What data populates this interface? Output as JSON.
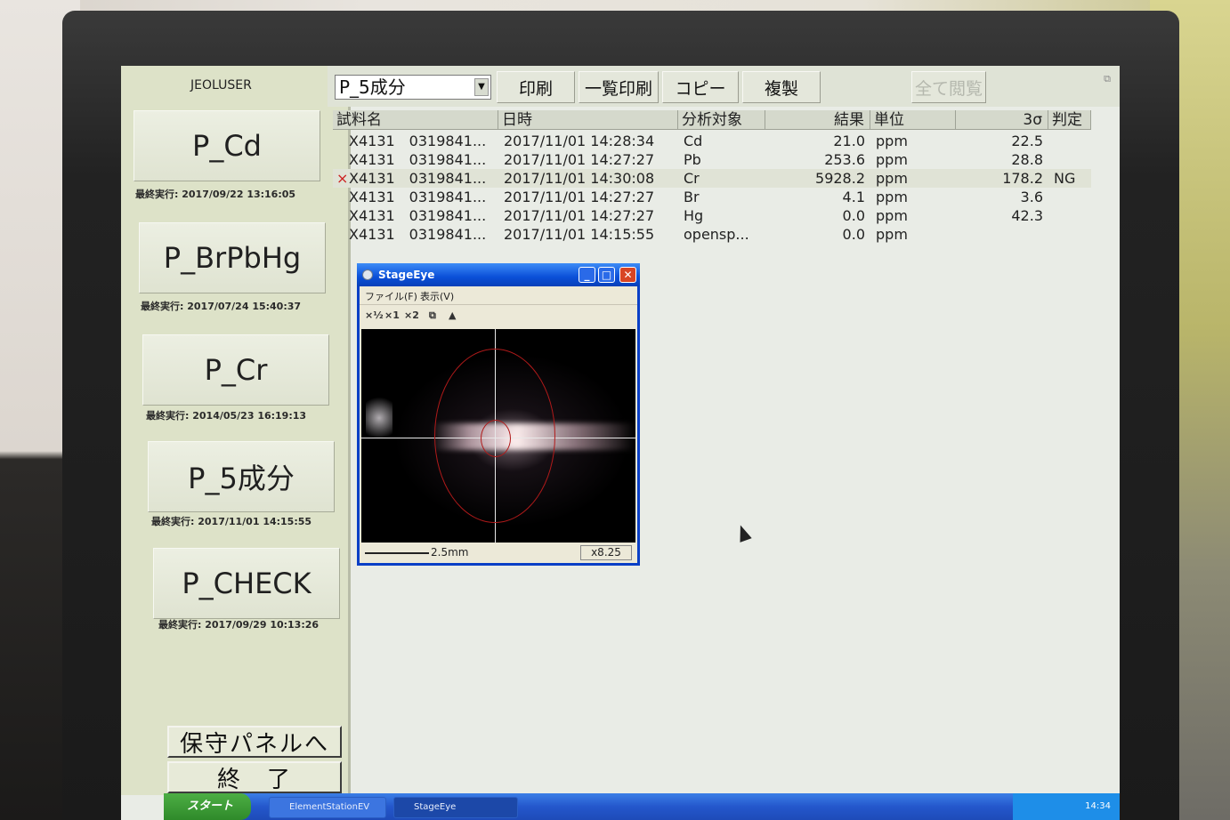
{
  "left_panel": {
    "user": "JEOLUSER",
    "programs": [
      {
        "label": "P_Cd",
        "last_run": "最終実行: 2017/09/22 13:16:05"
      },
      {
        "label": "P_BrPbHg",
        "last_run": "最終実行: 2017/07/24 15:40:37"
      },
      {
        "label": "P_Cr",
        "last_run": "最終実行: 2014/05/23 16:19:13"
      },
      {
        "label": "P_5成分",
        "last_run": "最終実行: 2017/11/01 14:15:55"
      },
      {
        "label": "P_CHECK",
        "last_run": "最終実行: 2017/09/29 10:13:26"
      }
    ],
    "maintenance_button": "保守パネルへ",
    "exit_button": "終　了"
  },
  "toolbar": {
    "selected_program": "P_5成分",
    "print": "印刷",
    "list_print": "一覧印刷",
    "copy": "コピー",
    "duplicate": "複製",
    "view_all": "全て閲覧"
  },
  "table": {
    "headers": [
      "試料名",
      "日時",
      "分析対象",
      "結果",
      "単位",
      "3σ",
      "判定"
    ],
    "rows": [
      {
        "flag": "",
        "sample": "X4131　0319841...",
        "datetime": "2017/11/01 14:28:34",
        "target": "Cd",
        "result": "21.0",
        "unit": "ppm",
        "sigma": "22.5",
        "judge": ""
      },
      {
        "flag": "",
        "sample": "X4131　0319841...",
        "datetime": "2017/11/01 14:27:27",
        "target": "Pb",
        "result": "253.6",
        "unit": "ppm",
        "sigma": "28.8",
        "judge": ""
      },
      {
        "flag": "×",
        "sample": "X4131　0319841...",
        "datetime": "2017/11/01 14:30:08",
        "target": "Cr",
        "result": "5928.2",
        "unit": "ppm",
        "sigma": "178.2",
        "judge": "NG"
      },
      {
        "flag": "",
        "sample": "X4131　0319841...",
        "datetime": "2017/11/01 14:27:27",
        "target": "Br",
        "result": "4.1",
        "unit": "ppm",
        "sigma": "3.6",
        "judge": ""
      },
      {
        "flag": "",
        "sample": "X4131　0319841...",
        "datetime": "2017/11/01 14:27:27",
        "target": "Hg",
        "result": "0.0",
        "unit": "ppm",
        "sigma": "42.3",
        "judge": ""
      },
      {
        "flag": "",
        "sample": "X4131　0319841...",
        "datetime": "2017/11/01 14:15:55",
        "target": "opensp...",
        "result": "0.0",
        "unit": "ppm",
        "sigma": "",
        "judge": ""
      }
    ]
  },
  "stage_eye": {
    "title": "StageEye",
    "menu_file": "ファイル(F)",
    "menu_view": "表示(V)",
    "tool_half": "×½",
    "tool_1": "×1",
    "tool_2": "×2",
    "scale": "2.5mm",
    "zoom": "x8.25"
  },
  "taskbar": {
    "start": "スタート",
    "task1": "ElementStationEV",
    "task2": "StageEye",
    "clock": "14:34"
  },
  "colors": {
    "ng_mark": "#cc2222",
    "titlebar": "#0a4fd8",
    "panel_bg": "#dde2c8"
  }
}
